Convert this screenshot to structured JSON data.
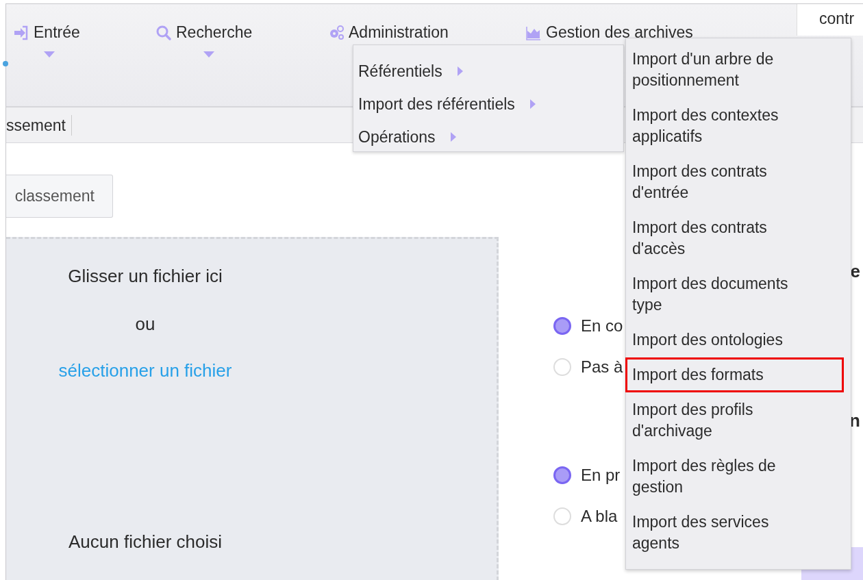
{
  "nav": {
    "items": [
      {
        "label": "Entrée",
        "caret": true
      },
      {
        "label": "Recherche",
        "caret": true
      },
      {
        "label": "Administration",
        "caret": false
      },
      {
        "label": "Gestion des archives",
        "caret": false
      }
    ],
    "field_value": "contr"
  },
  "sub_bar": {
    "text": "ssement"
  },
  "button": {
    "label": "classement"
  },
  "dropzone": {
    "prompt": "Glisser un fichier ici",
    "separator": "ou",
    "link": "sélectionner un fichier",
    "status": "Aucun fichier choisi"
  },
  "options": [
    {
      "heading": "e",
      "radios": [
        {
          "label": "En co",
          "selected": true
        },
        {
          "label": "Pas à",
          "selected": false
        }
      ]
    },
    {
      "heading": "n",
      "radios": [
        {
          "label": "En pr",
          "selected": true
        },
        {
          "label": "A bla",
          "selected": false
        }
      ]
    }
  ],
  "admin_menu": {
    "items": [
      {
        "label": "Référentiels"
      },
      {
        "label": "Import des référentiels"
      },
      {
        "label": "Opérations"
      }
    ]
  },
  "submenu": {
    "items": [
      {
        "label": "Import d'un arbre de positionnement",
        "selected": false
      },
      {
        "label": "Import des contextes applicatifs",
        "selected": false
      },
      {
        "label": "Import des contrats d'entrée",
        "selected": false
      },
      {
        "label": "Import des contrats d'accès",
        "selected": false
      },
      {
        "label": "Import des documents type",
        "selected": false
      },
      {
        "label": "Import des ontologies",
        "selected": false
      },
      {
        "label": "Import des formats",
        "selected": true
      },
      {
        "label": "Import des profils d'archivage",
        "selected": false
      },
      {
        "label": "Import des règles de gestion",
        "selected": false
      },
      {
        "label": "Import des services agents",
        "selected": false
      }
    ]
  }
}
